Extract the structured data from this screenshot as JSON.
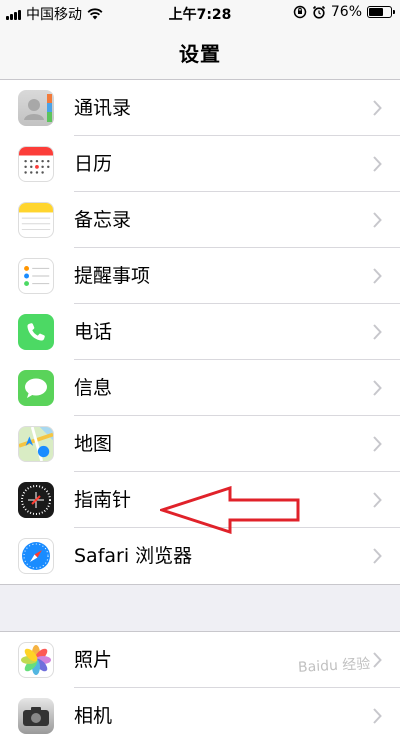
{
  "status_bar": {
    "carrier": "中国移动",
    "time": "上午7:28",
    "battery_percent": "76%",
    "battery_level": 0.76
  },
  "nav": {
    "title": "设置"
  },
  "rows": [
    {
      "label": "通讯录",
      "icon": "contacts-icon"
    },
    {
      "label": "日历",
      "icon": "calendar-icon"
    },
    {
      "label": "备忘录",
      "icon": "notes-icon"
    },
    {
      "label": "提醒事项",
      "icon": "reminders-icon"
    },
    {
      "label": "电话",
      "icon": "phone-icon"
    },
    {
      "label": "信息",
      "icon": "messages-icon"
    },
    {
      "label": "地图",
      "icon": "maps-icon"
    },
    {
      "label": "指南针",
      "icon": "compass-icon"
    },
    {
      "label": "Safari 浏览器",
      "icon": "safari-icon"
    }
  ],
  "rows_group2": [
    {
      "label": "照片",
      "icon": "photos-icon"
    },
    {
      "label": "相机",
      "icon": "camera-icon"
    }
  ],
  "watermark": "Baidu 经验",
  "colors": {
    "phone_green": "#4cd964",
    "messages_green": "#5ad35a",
    "calendar_red": "#fc3d39",
    "notes_yellow": "#ffd52e",
    "safari_blue": "#1a8cff",
    "arrow_red": "#e0222a",
    "chevron_gray": "#c7c7cc"
  }
}
